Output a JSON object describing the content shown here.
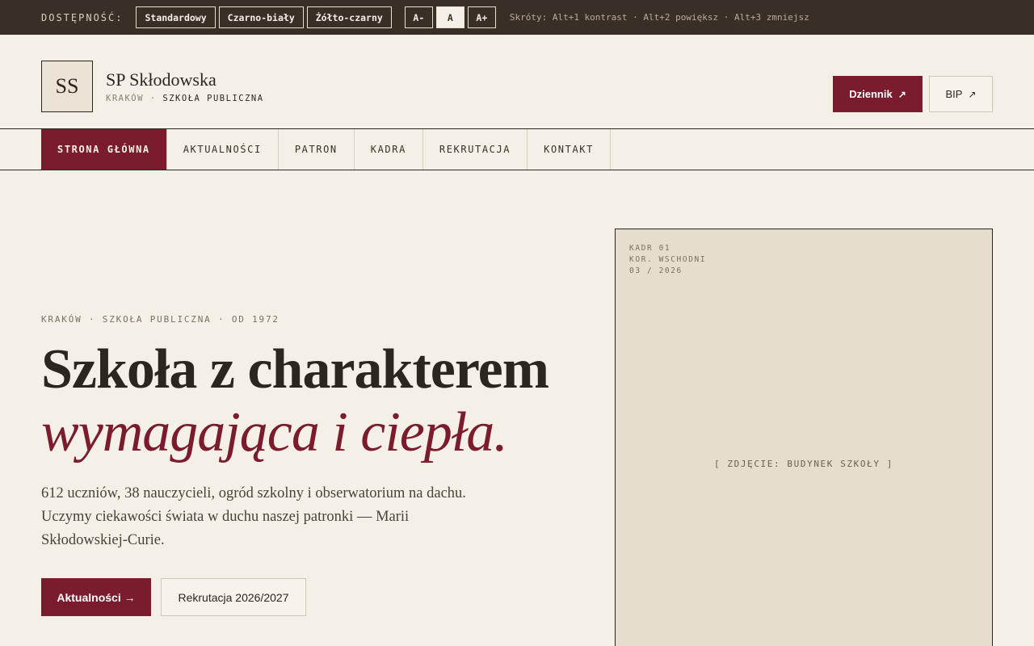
{
  "accessibility": {
    "label": "DOSTĘPNOŚĆ:",
    "modes": [
      "Standardowy",
      "Czarno-biały",
      "Żółto-czarny"
    ],
    "sizes": [
      "A-",
      "A",
      "A+"
    ],
    "shortcuts": "Skróty: Alt+1 kontrast · Alt+2 powiększ · Alt+3 zmniejsz"
  },
  "header": {
    "logo_text": "SS",
    "school_name": "SP Skłodowska",
    "subtitle_city": "KRAKÓW ·",
    "subtitle_type": "SZKOŁA PUBLICZNA",
    "dziennik_label": "Dziennik",
    "bip_label": "BIP",
    "external_arrow": "↗"
  },
  "nav": {
    "items": [
      "STRONA GŁÓWNA",
      "AKTUALNOŚCI",
      "PATRON",
      "KADRA",
      "REKRUTACJA",
      "KONTAKT"
    ],
    "active_index": 0
  },
  "hero": {
    "kicker": "KRAKÓW · SZKOŁA PUBLICZNA · OD 1972",
    "title_line1": "Szkoła z charakterem",
    "title_line2": "wymagająca i ciepła.",
    "lead": "612 uczniów, 38 nauczycieli, ogród szkolny i obserwatorium na dachu. Uczymy ciekawości świata w duchu naszej patronki — Marii Skłodowskiej-Curie.",
    "cta_primary": "Aktualności →",
    "cta_secondary": "Rekrutacja 2026/2027"
  },
  "photo": {
    "meta_line1": "KADR 01",
    "meta_line2": "KOR. WSCHODNI",
    "meta_line3": "03 / 2026",
    "caption": "[ ZDJĘCIE: BUDYNEK SZKOŁY ]"
  },
  "colors": {
    "accent": "#7a1c2e",
    "background": "#f5f0e7",
    "topbar": "#3a2f26"
  }
}
